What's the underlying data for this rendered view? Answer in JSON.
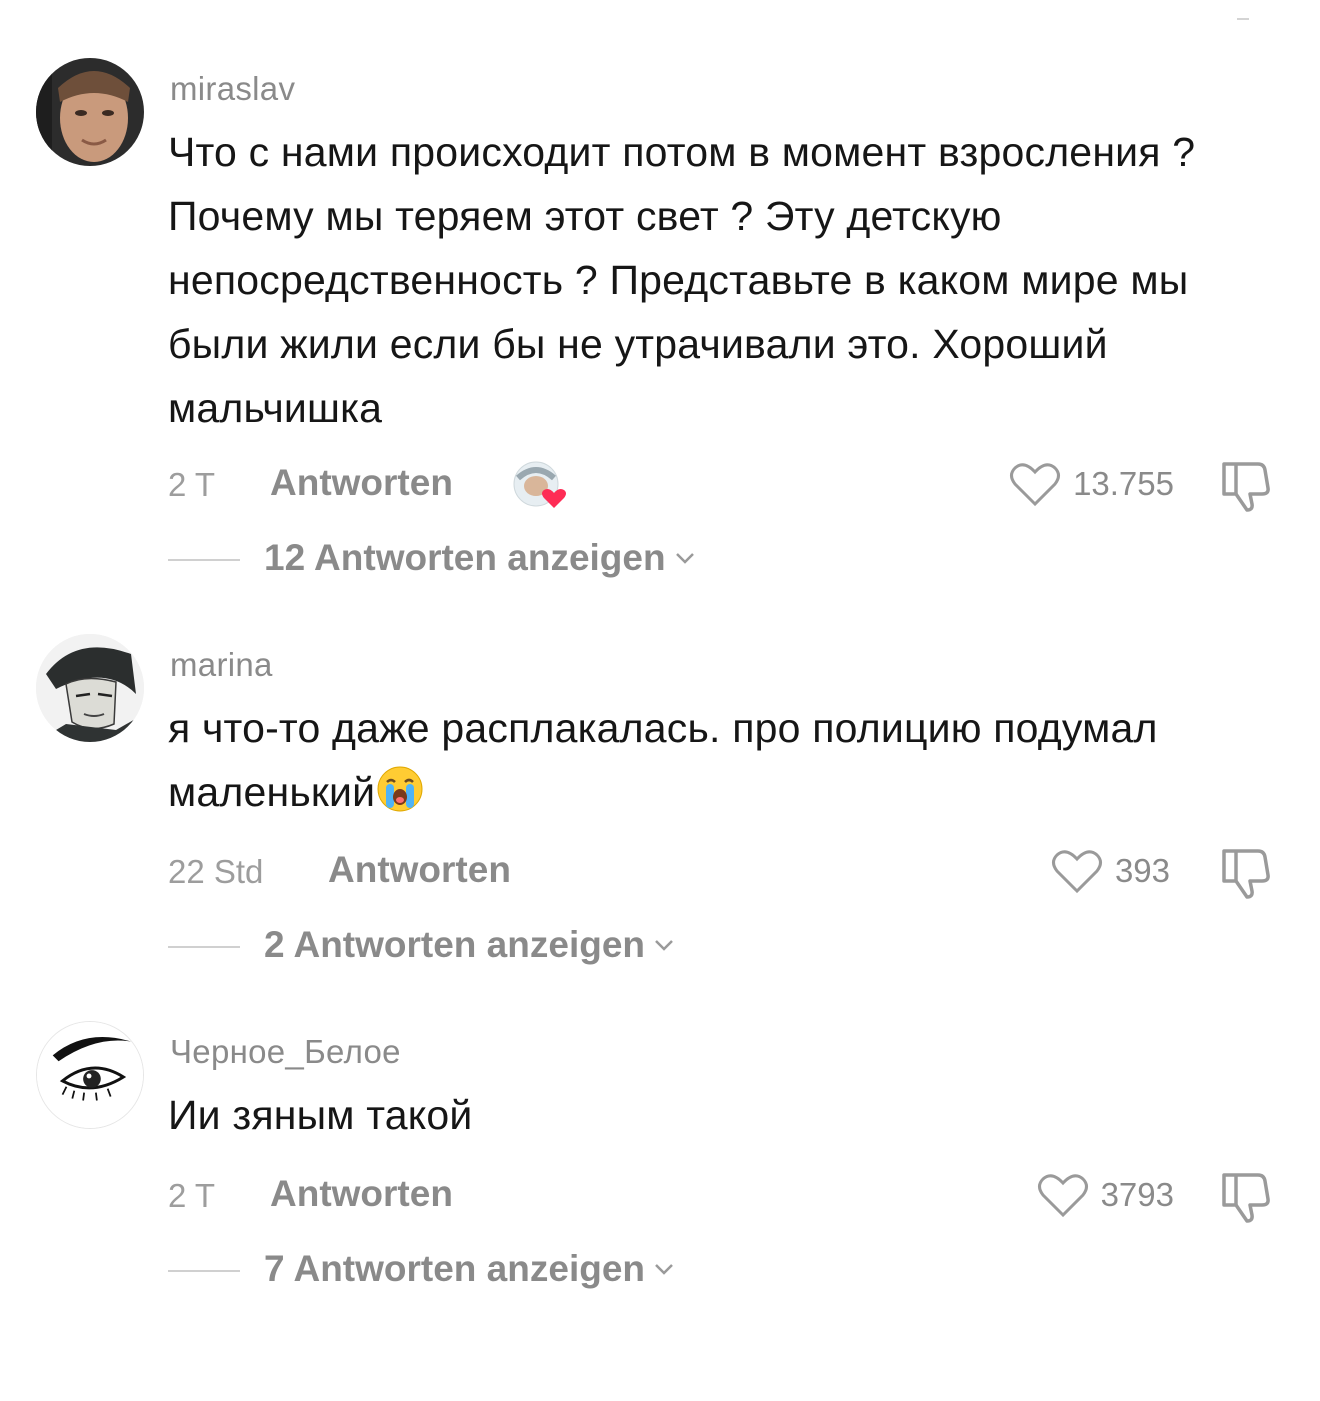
{
  "comments": [
    {
      "username": "miraslav",
      "text": "Что с нами происходит потом в момент взросления ? Почему мы теряем этот свет ? Эту детскую непосредственность ? Представьте в каком мире мы были жили если бы не утрачивали это. Хороший мальчишка",
      "time": "2 T",
      "reply_label": "Antworten",
      "likes": "13.755",
      "creator_liked": true,
      "view_replies": "12 Antworten anzeigen"
    },
    {
      "username": "marina",
      "text": "я что-то даже расплакалась. про полицию подумал маленький",
      "emoji": "loudly-crying-face-icon",
      "time": "22 Std",
      "reply_label": "Antworten",
      "likes": "393",
      "view_replies": "2 Antworten anzeigen"
    },
    {
      "username": "Черное_Белое",
      "text": "Ии зяным такой",
      "time": "2 T",
      "reply_label": "Antworten",
      "likes": "3793",
      "view_replies": "7 Antworten anzeigen"
    }
  ],
  "colors": {
    "text": "#161616",
    "muted": "#8a8a8a",
    "like_badge": "#fe2c55"
  }
}
